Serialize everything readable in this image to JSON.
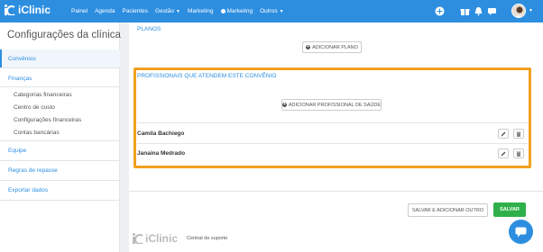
{
  "brand": {
    "name": "iClinic"
  },
  "nav": {
    "items": [
      {
        "label": "Painel"
      },
      {
        "label": "Agenda"
      },
      {
        "label": "Pacientes"
      },
      {
        "label": "Gestão"
      },
      {
        "label": "Marketing"
      },
      {
        "label": "Marketing"
      },
      {
        "label": "Outros"
      }
    ]
  },
  "sidebar": {
    "title": "Configurações da clínica",
    "items": [
      {
        "label": "Convênios"
      },
      {
        "label": "Finanças"
      },
      {
        "label": "Categorias financeiras"
      },
      {
        "label": "Centro de custo"
      },
      {
        "label": "Configurações financeiras"
      },
      {
        "label": "Contas bancárias"
      },
      {
        "label": "Equipe"
      },
      {
        "label": "Regras de repasse"
      },
      {
        "label": "Exportar dados"
      }
    ]
  },
  "main": {
    "planos_label": "PLANOS",
    "add_plan_label": "ADICIONAR PLANO",
    "professionals_label": "PROFISSIONAIS QUE ATENDEM ESTE CONVÊNIO",
    "add_professional_label": "ADICIONAR PROFISSIONAL DE SAÚDE",
    "professionals": [
      {
        "name": "Camila Bachiego"
      },
      {
        "name": "Janaina Medrado"
      }
    ],
    "save_and_add_label": "SALVAR E ADICIONAR OUTRO",
    "save_label": "SALVAR"
  },
  "footer": {
    "brand": "iClinic",
    "support_label": "Central de suporte"
  },
  "colors": {
    "primary": "#2d8ee0",
    "highlight": "#f0a020",
    "save": "#2fb04a"
  }
}
